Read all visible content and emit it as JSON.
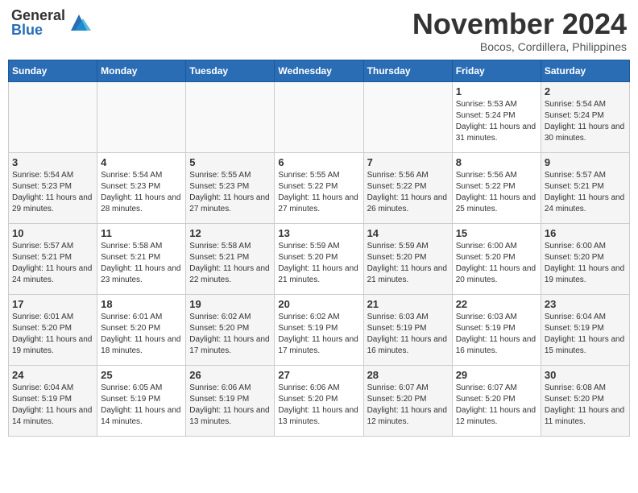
{
  "logo": {
    "general": "General",
    "blue": "Blue"
  },
  "title": "November 2024",
  "subtitle": "Bocos, Cordillera, Philippines",
  "days_of_week": [
    "Sunday",
    "Monday",
    "Tuesday",
    "Wednesday",
    "Thursday",
    "Friday",
    "Saturday"
  ],
  "weeks": [
    [
      {
        "day": "",
        "sunrise": "",
        "sunset": "",
        "daylight": ""
      },
      {
        "day": "",
        "sunrise": "",
        "sunset": "",
        "daylight": ""
      },
      {
        "day": "",
        "sunrise": "",
        "sunset": "",
        "daylight": ""
      },
      {
        "day": "",
        "sunrise": "",
        "sunset": "",
        "daylight": ""
      },
      {
        "day": "",
        "sunrise": "",
        "sunset": "",
        "daylight": ""
      },
      {
        "day": "1",
        "sunrise": "Sunrise: 5:53 AM",
        "sunset": "Sunset: 5:24 PM",
        "daylight": "Daylight: 11 hours and 31 minutes."
      },
      {
        "day": "2",
        "sunrise": "Sunrise: 5:54 AM",
        "sunset": "Sunset: 5:24 PM",
        "daylight": "Daylight: 11 hours and 30 minutes."
      }
    ],
    [
      {
        "day": "3",
        "sunrise": "Sunrise: 5:54 AM",
        "sunset": "Sunset: 5:23 PM",
        "daylight": "Daylight: 11 hours and 29 minutes."
      },
      {
        "day": "4",
        "sunrise": "Sunrise: 5:54 AM",
        "sunset": "Sunset: 5:23 PM",
        "daylight": "Daylight: 11 hours and 28 minutes."
      },
      {
        "day": "5",
        "sunrise": "Sunrise: 5:55 AM",
        "sunset": "Sunset: 5:23 PM",
        "daylight": "Daylight: 11 hours and 27 minutes."
      },
      {
        "day": "6",
        "sunrise": "Sunrise: 5:55 AM",
        "sunset": "Sunset: 5:22 PM",
        "daylight": "Daylight: 11 hours and 27 minutes."
      },
      {
        "day": "7",
        "sunrise": "Sunrise: 5:56 AM",
        "sunset": "Sunset: 5:22 PM",
        "daylight": "Daylight: 11 hours and 26 minutes."
      },
      {
        "day": "8",
        "sunrise": "Sunrise: 5:56 AM",
        "sunset": "Sunset: 5:22 PM",
        "daylight": "Daylight: 11 hours and 25 minutes."
      },
      {
        "day": "9",
        "sunrise": "Sunrise: 5:57 AM",
        "sunset": "Sunset: 5:21 PM",
        "daylight": "Daylight: 11 hours and 24 minutes."
      }
    ],
    [
      {
        "day": "10",
        "sunrise": "Sunrise: 5:57 AM",
        "sunset": "Sunset: 5:21 PM",
        "daylight": "Daylight: 11 hours and 24 minutes."
      },
      {
        "day": "11",
        "sunrise": "Sunrise: 5:58 AM",
        "sunset": "Sunset: 5:21 PM",
        "daylight": "Daylight: 11 hours and 23 minutes."
      },
      {
        "day": "12",
        "sunrise": "Sunrise: 5:58 AM",
        "sunset": "Sunset: 5:21 PM",
        "daylight": "Daylight: 11 hours and 22 minutes."
      },
      {
        "day": "13",
        "sunrise": "Sunrise: 5:59 AM",
        "sunset": "Sunset: 5:20 PM",
        "daylight": "Daylight: 11 hours and 21 minutes."
      },
      {
        "day": "14",
        "sunrise": "Sunrise: 5:59 AM",
        "sunset": "Sunset: 5:20 PM",
        "daylight": "Daylight: 11 hours and 21 minutes."
      },
      {
        "day": "15",
        "sunrise": "Sunrise: 6:00 AM",
        "sunset": "Sunset: 5:20 PM",
        "daylight": "Daylight: 11 hours and 20 minutes."
      },
      {
        "day": "16",
        "sunrise": "Sunrise: 6:00 AM",
        "sunset": "Sunset: 5:20 PM",
        "daylight": "Daylight: 11 hours and 19 minutes."
      }
    ],
    [
      {
        "day": "17",
        "sunrise": "Sunrise: 6:01 AM",
        "sunset": "Sunset: 5:20 PM",
        "daylight": "Daylight: 11 hours and 19 minutes."
      },
      {
        "day": "18",
        "sunrise": "Sunrise: 6:01 AM",
        "sunset": "Sunset: 5:20 PM",
        "daylight": "Daylight: 11 hours and 18 minutes."
      },
      {
        "day": "19",
        "sunrise": "Sunrise: 6:02 AM",
        "sunset": "Sunset: 5:20 PM",
        "daylight": "Daylight: 11 hours and 17 minutes."
      },
      {
        "day": "20",
        "sunrise": "Sunrise: 6:02 AM",
        "sunset": "Sunset: 5:19 PM",
        "daylight": "Daylight: 11 hours and 17 minutes."
      },
      {
        "day": "21",
        "sunrise": "Sunrise: 6:03 AM",
        "sunset": "Sunset: 5:19 PM",
        "daylight": "Daylight: 11 hours and 16 minutes."
      },
      {
        "day": "22",
        "sunrise": "Sunrise: 6:03 AM",
        "sunset": "Sunset: 5:19 PM",
        "daylight": "Daylight: 11 hours and 16 minutes."
      },
      {
        "day": "23",
        "sunrise": "Sunrise: 6:04 AM",
        "sunset": "Sunset: 5:19 PM",
        "daylight": "Daylight: 11 hours and 15 minutes."
      }
    ],
    [
      {
        "day": "24",
        "sunrise": "Sunrise: 6:04 AM",
        "sunset": "Sunset: 5:19 PM",
        "daylight": "Daylight: 11 hours and 14 minutes."
      },
      {
        "day": "25",
        "sunrise": "Sunrise: 6:05 AM",
        "sunset": "Sunset: 5:19 PM",
        "daylight": "Daylight: 11 hours and 14 minutes."
      },
      {
        "day": "26",
        "sunrise": "Sunrise: 6:06 AM",
        "sunset": "Sunset: 5:19 PM",
        "daylight": "Daylight: 11 hours and 13 minutes."
      },
      {
        "day": "27",
        "sunrise": "Sunrise: 6:06 AM",
        "sunset": "Sunset: 5:20 PM",
        "daylight": "Daylight: 11 hours and 13 minutes."
      },
      {
        "day": "28",
        "sunrise": "Sunrise: 6:07 AM",
        "sunset": "Sunset: 5:20 PM",
        "daylight": "Daylight: 11 hours and 12 minutes."
      },
      {
        "day": "29",
        "sunrise": "Sunrise: 6:07 AM",
        "sunset": "Sunset: 5:20 PM",
        "daylight": "Daylight: 11 hours and 12 minutes."
      },
      {
        "day": "30",
        "sunrise": "Sunrise: 6:08 AM",
        "sunset": "Sunset: 5:20 PM",
        "daylight": "Daylight: 11 hours and 11 minutes."
      }
    ]
  ]
}
